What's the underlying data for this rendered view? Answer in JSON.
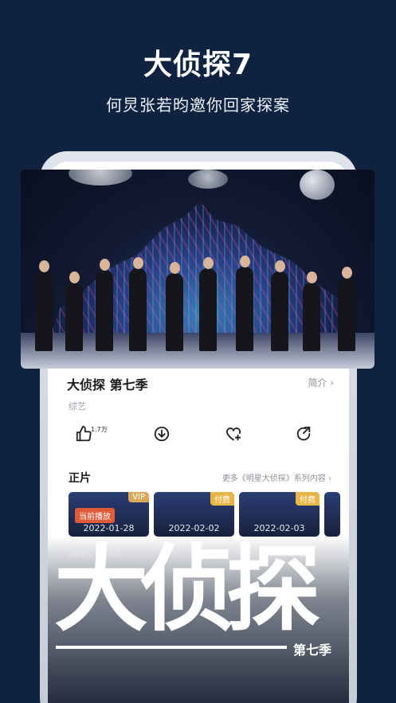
{
  "promo": {
    "headline": "大侦探7",
    "subline": "何炅张若昀邀你回家探案"
  },
  "show": {
    "title": "大侦探 第七季",
    "intro_label": "简介 ›",
    "genre": "综艺",
    "likes_count": "1.7万"
  },
  "episodes_section": {
    "title": "正片",
    "more_label": "更多《明星大侦探》系列内容 ›",
    "items": [
      {
        "tag": "VIP",
        "date": "2022-01-28",
        "now_playing": "当前播放"
      },
      {
        "tag": "付费",
        "date": "2022-02-02"
      },
      {
        "tag": "付费",
        "date": "2022-02-03"
      }
    ],
    "captions": "超前        会员"
  },
  "logo": {
    "main": "大侦探",
    "sub": "第七季"
  },
  "colors": {
    "background": "#0f2240",
    "accent": "#e05b3a",
    "vip_tag": "#d9a85a"
  }
}
